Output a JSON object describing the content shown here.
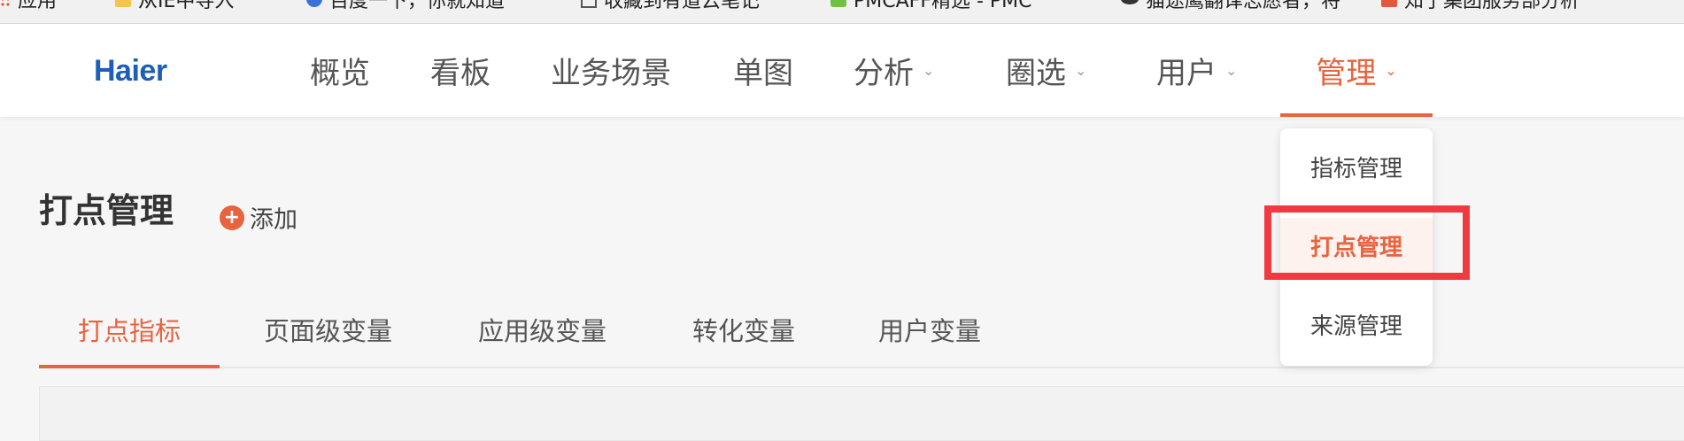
{
  "bookmarks": [
    {
      "label": "应用",
      "icon": "apps-icon"
    },
    {
      "label": "从IE中导入",
      "icon": "folder-icon"
    },
    {
      "label": "百度一下，你就知道",
      "icon": "baidu-paw-icon"
    },
    {
      "label": "收藏到有道云笔记",
      "icon": "document-icon"
    },
    {
      "label": "PMCAFF精选 - PMC",
      "icon": "pmcaff-icon"
    },
    {
      "label": "猫途鹰翻译志愿者，将",
      "icon": "owl-icon"
    },
    {
      "label": "知了集团服务部分析",
      "icon": "zhiliao-icon"
    }
  ],
  "brand": {
    "logo_text": "Haier",
    "color": "#1d5fb8"
  },
  "nav": {
    "items": [
      {
        "label": "概览"
      },
      {
        "label": "看板"
      },
      {
        "label": "业务场景"
      },
      {
        "label": "单图"
      },
      {
        "label": "分析",
        "caret": "⌄"
      },
      {
        "label": "圈选",
        "caret": "⌄"
      },
      {
        "label": "用户",
        "caret": "⌄"
      },
      {
        "label": "管理",
        "caret": "⌄",
        "active": true
      }
    ],
    "accent_color": "#e8633e"
  },
  "dropdown": {
    "items": [
      {
        "label": "指标管理"
      },
      {
        "label": "打点管理",
        "selected": true
      },
      {
        "label": "来源管理"
      }
    ],
    "highlight_color": "#f03a3f"
  },
  "page": {
    "title": "打点管理",
    "add_label": "添加",
    "add_icon": "plus-circle-icon"
  },
  "tabs": [
    {
      "label": "打点指标",
      "active": true
    },
    {
      "label": "页面级变量"
    },
    {
      "label": "应用级变量"
    },
    {
      "label": "转化变量"
    },
    {
      "label": "用户变量"
    }
  ]
}
